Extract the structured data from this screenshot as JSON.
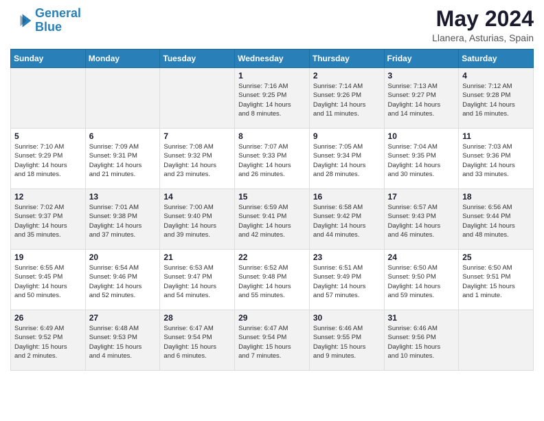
{
  "header": {
    "logo_line1": "General",
    "logo_line2": "Blue",
    "month_year": "May 2024",
    "location": "Llanera, Asturias, Spain"
  },
  "weekdays": [
    "Sunday",
    "Monday",
    "Tuesday",
    "Wednesday",
    "Thursday",
    "Friday",
    "Saturday"
  ],
  "weeks": [
    [
      {
        "day": "",
        "info": ""
      },
      {
        "day": "",
        "info": ""
      },
      {
        "day": "",
        "info": ""
      },
      {
        "day": "1",
        "info": "Sunrise: 7:16 AM\nSunset: 9:25 PM\nDaylight: 14 hours\nand 8 minutes."
      },
      {
        "day": "2",
        "info": "Sunrise: 7:14 AM\nSunset: 9:26 PM\nDaylight: 14 hours\nand 11 minutes."
      },
      {
        "day": "3",
        "info": "Sunrise: 7:13 AM\nSunset: 9:27 PM\nDaylight: 14 hours\nand 14 minutes."
      },
      {
        "day": "4",
        "info": "Sunrise: 7:12 AM\nSunset: 9:28 PM\nDaylight: 14 hours\nand 16 minutes."
      }
    ],
    [
      {
        "day": "5",
        "info": "Sunrise: 7:10 AM\nSunset: 9:29 PM\nDaylight: 14 hours\nand 18 minutes."
      },
      {
        "day": "6",
        "info": "Sunrise: 7:09 AM\nSunset: 9:31 PM\nDaylight: 14 hours\nand 21 minutes."
      },
      {
        "day": "7",
        "info": "Sunrise: 7:08 AM\nSunset: 9:32 PM\nDaylight: 14 hours\nand 23 minutes."
      },
      {
        "day": "8",
        "info": "Sunrise: 7:07 AM\nSunset: 9:33 PM\nDaylight: 14 hours\nand 26 minutes."
      },
      {
        "day": "9",
        "info": "Sunrise: 7:05 AM\nSunset: 9:34 PM\nDaylight: 14 hours\nand 28 minutes."
      },
      {
        "day": "10",
        "info": "Sunrise: 7:04 AM\nSunset: 9:35 PM\nDaylight: 14 hours\nand 30 minutes."
      },
      {
        "day": "11",
        "info": "Sunrise: 7:03 AM\nSunset: 9:36 PM\nDaylight: 14 hours\nand 33 minutes."
      }
    ],
    [
      {
        "day": "12",
        "info": "Sunrise: 7:02 AM\nSunset: 9:37 PM\nDaylight: 14 hours\nand 35 minutes."
      },
      {
        "day": "13",
        "info": "Sunrise: 7:01 AM\nSunset: 9:38 PM\nDaylight: 14 hours\nand 37 minutes."
      },
      {
        "day": "14",
        "info": "Sunrise: 7:00 AM\nSunset: 9:40 PM\nDaylight: 14 hours\nand 39 minutes."
      },
      {
        "day": "15",
        "info": "Sunrise: 6:59 AM\nSunset: 9:41 PM\nDaylight: 14 hours\nand 42 minutes."
      },
      {
        "day": "16",
        "info": "Sunrise: 6:58 AM\nSunset: 9:42 PM\nDaylight: 14 hours\nand 44 minutes."
      },
      {
        "day": "17",
        "info": "Sunrise: 6:57 AM\nSunset: 9:43 PM\nDaylight: 14 hours\nand 46 minutes."
      },
      {
        "day": "18",
        "info": "Sunrise: 6:56 AM\nSunset: 9:44 PM\nDaylight: 14 hours\nand 48 minutes."
      }
    ],
    [
      {
        "day": "19",
        "info": "Sunrise: 6:55 AM\nSunset: 9:45 PM\nDaylight: 14 hours\nand 50 minutes."
      },
      {
        "day": "20",
        "info": "Sunrise: 6:54 AM\nSunset: 9:46 PM\nDaylight: 14 hours\nand 52 minutes."
      },
      {
        "day": "21",
        "info": "Sunrise: 6:53 AM\nSunset: 9:47 PM\nDaylight: 14 hours\nand 54 minutes."
      },
      {
        "day": "22",
        "info": "Sunrise: 6:52 AM\nSunset: 9:48 PM\nDaylight: 14 hours\nand 55 minutes."
      },
      {
        "day": "23",
        "info": "Sunrise: 6:51 AM\nSunset: 9:49 PM\nDaylight: 14 hours\nand 57 minutes."
      },
      {
        "day": "24",
        "info": "Sunrise: 6:50 AM\nSunset: 9:50 PM\nDaylight: 14 hours\nand 59 minutes."
      },
      {
        "day": "25",
        "info": "Sunrise: 6:50 AM\nSunset: 9:51 PM\nDaylight: 15 hours\nand 1 minute."
      }
    ],
    [
      {
        "day": "26",
        "info": "Sunrise: 6:49 AM\nSunset: 9:52 PM\nDaylight: 15 hours\nand 2 minutes."
      },
      {
        "day": "27",
        "info": "Sunrise: 6:48 AM\nSunset: 9:53 PM\nDaylight: 15 hours\nand 4 minutes."
      },
      {
        "day": "28",
        "info": "Sunrise: 6:47 AM\nSunset: 9:54 PM\nDaylight: 15 hours\nand 6 minutes."
      },
      {
        "day": "29",
        "info": "Sunrise: 6:47 AM\nSunset: 9:54 PM\nDaylight: 15 hours\nand 7 minutes."
      },
      {
        "day": "30",
        "info": "Sunrise: 6:46 AM\nSunset: 9:55 PM\nDaylight: 15 hours\nand 9 minutes."
      },
      {
        "day": "31",
        "info": "Sunrise: 6:46 AM\nSunset: 9:56 PM\nDaylight: 15 hours\nand 10 minutes."
      },
      {
        "day": "",
        "info": ""
      }
    ]
  ]
}
